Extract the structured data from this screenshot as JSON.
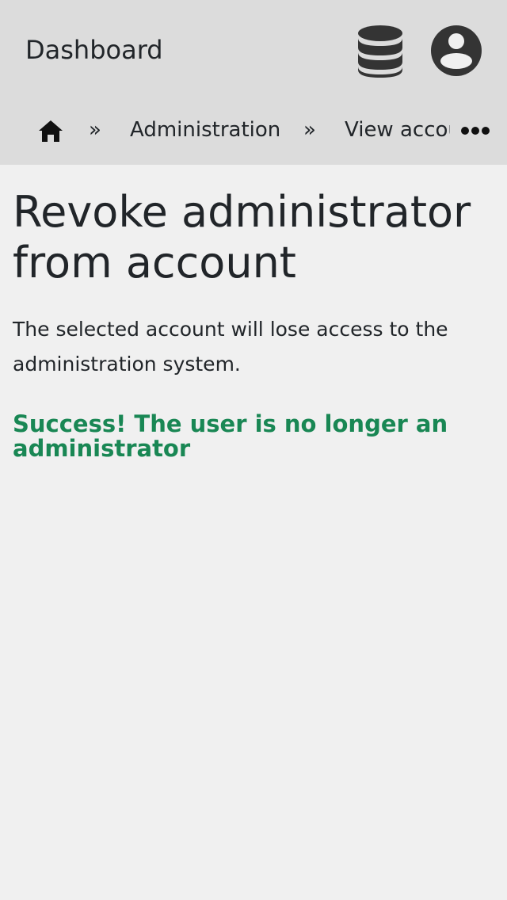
{
  "header": {
    "title": "Dashboard",
    "icons": {
      "database": "database-icon",
      "account": "account-circle-icon"
    }
  },
  "breadcrumb": {
    "home_icon": "home-icon",
    "separator": "»",
    "items": [
      {
        "label": "Administration"
      },
      {
        "label": "View account"
      }
    ],
    "overflow_icon": "more-horizontal-icon"
  },
  "main": {
    "title": "Revoke administrator from account",
    "description": "The selected account will lose access to the administration system.",
    "success": "Success! The user is no longer an administrator"
  },
  "colors": {
    "header_bg": "#dcdcdc",
    "page_bg": "#f0f0f0",
    "text": "#212529",
    "success": "#198754",
    "icon": "#343434"
  }
}
